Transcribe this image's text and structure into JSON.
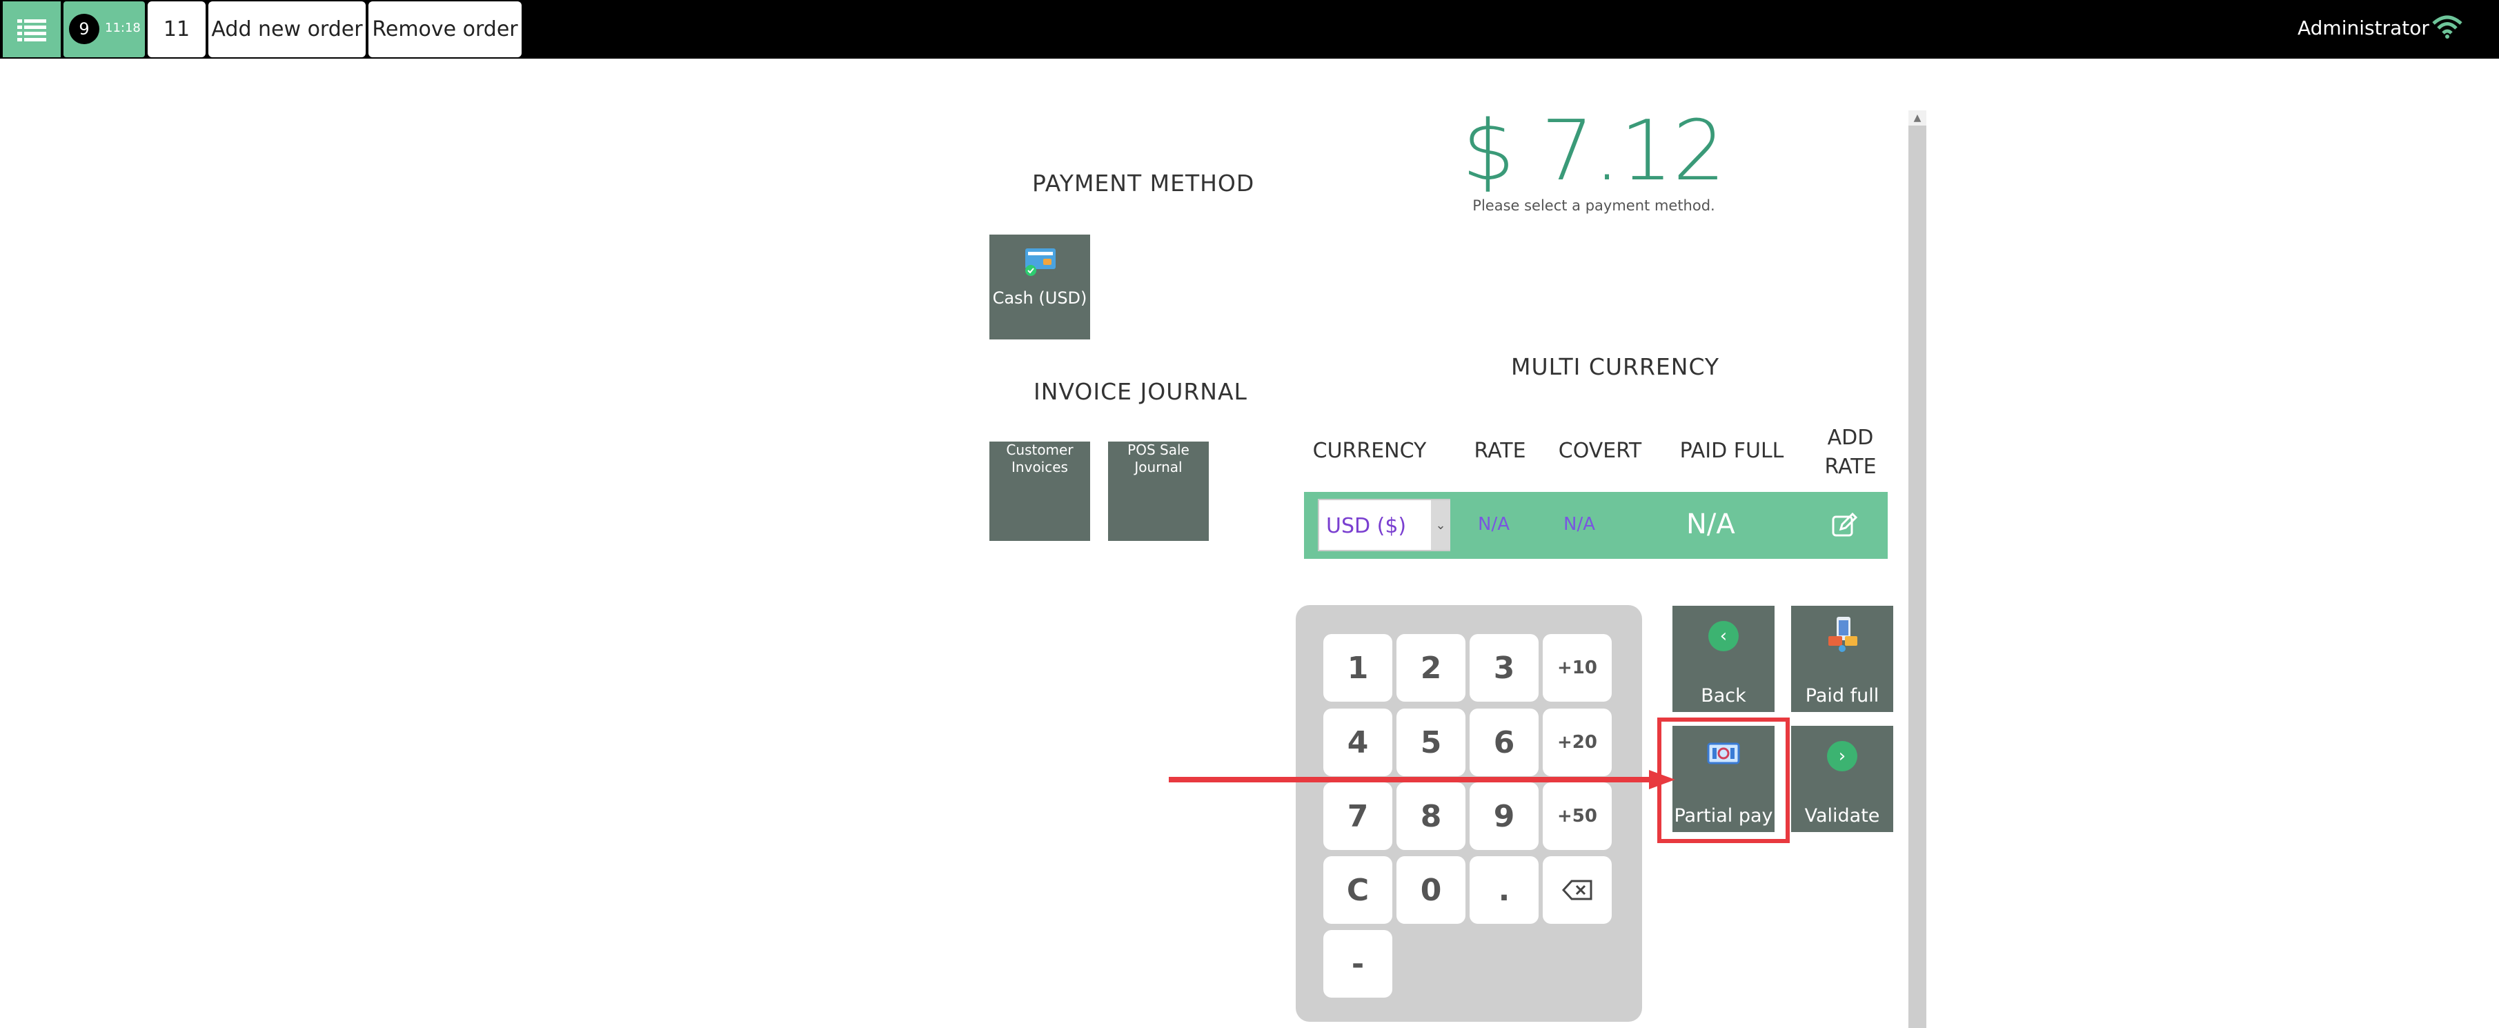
{
  "topbar": {
    "order_number": "9",
    "order_time": "11:18",
    "order_tab_2": "11",
    "add_order_label": "Add new order",
    "remove_order_label": "Remove order",
    "user_name": "Administrator",
    "icons": [
      "list-icon",
      "wifi-icon"
    ]
  },
  "payment": {
    "amount": "$ 7.12",
    "hint": "Please select a payment method.",
    "method_heading": "PAYMENT METHOD",
    "methods": [
      {
        "label": "Cash (USD)",
        "icon": "cash-card-icon"
      }
    ],
    "journal_heading": "INVOICE JOURNAL",
    "journals": [
      {
        "label": "Customer Invoices"
      },
      {
        "label": "POS Sale Journal"
      }
    ]
  },
  "multi_currency": {
    "heading": "MULTI CURRENCY",
    "columns": [
      "CURRENCY",
      "RATE",
      "COVERT",
      "PAID FULL",
      "ADD RATE"
    ],
    "row": {
      "currency": "USD ($)",
      "rate": "N/A",
      "covert": "N/A",
      "paid_full": "N/A",
      "edit_icon": "edit-icon"
    }
  },
  "keypad": {
    "keys": [
      "1",
      "2",
      "3",
      "+10",
      "4",
      "5",
      "6",
      "+20",
      "7",
      "8",
      "9",
      "+50",
      "C",
      "0",
      ".",
      "backspace",
      "-"
    ]
  },
  "actions": {
    "back": "Back",
    "paid_full": "Paid full",
    "partial_pay": "Partial pay",
    "validate": "Validate"
  },
  "annotation": {
    "highlight_color": "#e8393f",
    "highlighted": "partial_pay"
  },
  "colors": {
    "accent": "#6ec59a",
    "tile": "#5f6e68",
    "amount": "#3a9a78"
  }
}
